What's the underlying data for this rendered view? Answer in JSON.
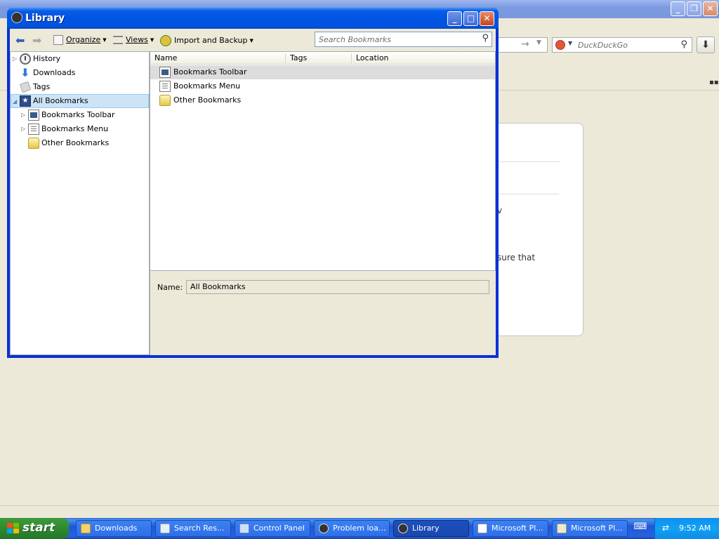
{
  "background_browser": {
    "search_engine": "DuckDuckGo",
    "page_snippets": [
      "v",
      "sure that"
    ]
  },
  "library": {
    "title": "Library",
    "toolbar": {
      "organize": "Organize",
      "views": "Views",
      "import_backup": "Import and Backup",
      "search_placeholder": "Search Bookmarks"
    },
    "tree": [
      {
        "label": "History",
        "icon": "history-icon",
        "expandable": true
      },
      {
        "label": "Downloads",
        "icon": "downloads-icon",
        "expandable": false
      },
      {
        "label": "Tags",
        "icon": "tags-icon",
        "expandable": false
      },
      {
        "label": "All Bookmarks",
        "icon": "all-bookmarks-icon",
        "expandable": true,
        "expanded": true,
        "selected": true
      },
      {
        "label": "Bookmarks Toolbar",
        "icon": "bookmarks-toolbar-icon",
        "expandable": true
      },
      {
        "label": "Bookmarks Menu",
        "icon": "bookmarks-menu-icon",
        "expandable": true
      },
      {
        "label": "Other Bookmarks",
        "icon": "other-bookmarks-icon",
        "expandable": false
      }
    ],
    "columns": [
      "Name",
      "Tags",
      "Location"
    ],
    "rows": [
      {
        "name": "Bookmarks Toolbar",
        "icon": "bookmarks-toolbar-icon",
        "selected": true
      },
      {
        "name": "Bookmarks Menu",
        "icon": "bookmarks-menu-icon"
      },
      {
        "name": "Other Bookmarks",
        "icon": "other-bookmarks-icon"
      }
    ],
    "details": {
      "name_label": "Name:",
      "name_value": "All Bookmarks"
    }
  },
  "taskbar": {
    "start_label": "start",
    "tasks": [
      {
        "label": "Downloads",
        "icon": "folder-icon"
      },
      {
        "label": "Search Res...",
        "icon": "search-results-icon"
      },
      {
        "label": "Control Panel",
        "icon": "control-panel-icon"
      },
      {
        "label": "Problem loa...",
        "icon": "firefox-icon"
      },
      {
        "label": "Library",
        "icon": "firefox-icon",
        "active": true
      },
      {
        "label": "Microsoft Pl...",
        "icon": "microsoft-pl-icon"
      },
      {
        "label": "Microsoft Pl...",
        "icon": "microsoft-pl-icon"
      }
    ],
    "clock": "9:52 AM"
  },
  "colors": {
    "xp_blue": "#0054e3",
    "start_green": "#2f8a2f",
    "selection": "#cde4f7"
  }
}
